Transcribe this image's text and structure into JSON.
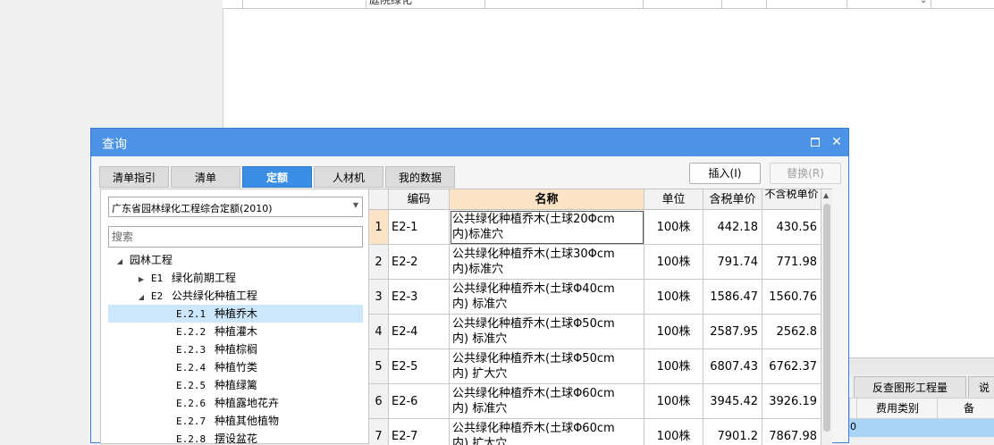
{
  "background": {
    "top_row_text": "庭院绿化"
  },
  "dialog": {
    "title": "查询",
    "tabs": [
      "清单指引",
      "清单",
      "定额",
      "人材机",
      "我的数据"
    ],
    "active_tab": "定额",
    "insert_button": "插入(I)",
    "replace_button": "替换(R)",
    "library_select": "广东省园林绿化工程综合定额(2010)",
    "search_placeholder": "搜索",
    "tree": [
      {
        "label": "园林工程",
        "toggle": "◢"
      },
      {
        "code": "E1",
        "label": "绿化前期工程",
        "toggle": "▶"
      },
      {
        "code": "E2",
        "label": "公共绿化种植工程",
        "toggle": "◢"
      },
      {
        "code": "E.2.1",
        "label": "种植乔木",
        "selected": true
      },
      {
        "code": "E.2.2",
        "label": "种植灌木"
      },
      {
        "code": "E.2.3",
        "label": "种植棕榈"
      },
      {
        "code": "E.2.4",
        "label": "种植竹类"
      },
      {
        "code": "E.2.5",
        "label": "种植绿篱"
      },
      {
        "code": "E.2.6",
        "label": "种植露地花卉"
      },
      {
        "code": "E.2.7",
        "label": "种植其他植物"
      },
      {
        "code": "E.2.8",
        "label": "摆设盆花"
      }
    ],
    "grid": {
      "headers": [
        "编码",
        "名称",
        "单位",
        "含税单价",
        "不含税单价"
      ],
      "rows": [
        {
          "idx": "1",
          "code": "E2-1",
          "name_l1": "公共绿化种植乔木(土球20Φcm",
          "name_l2": "内)标准穴",
          "unit": "100株",
          "price_tax": "442.18",
          "price_notax": "430.56"
        },
        {
          "idx": "2",
          "code": "E2-2",
          "name_l1": "公共绿化种植乔木(土球30Φcm",
          "name_l2": "内)标准穴",
          "unit": "100株",
          "price_tax": "791.74",
          "price_notax": "771.98"
        },
        {
          "idx": "3",
          "code": "E2-3",
          "name_l1": "公共绿化种植乔木(土球Φ40cm",
          "name_l2": "内) 标准穴",
          "unit": "100株",
          "price_tax": "1586.47",
          "price_notax": "1560.76"
        },
        {
          "idx": "4",
          "code": "E2-4",
          "name_l1": "公共绿化种植乔木(土球Φ50cm",
          "name_l2": "内) 标准穴",
          "unit": "100株",
          "price_tax": "2587.95",
          "price_notax": "2562.8"
        },
        {
          "idx": "5",
          "code": "E2-5",
          "name_l1": "公共绿化种植乔木(土球Φ50cm",
          "name_l2": "内) 扩大穴",
          "unit": "100株",
          "price_tax": "6807.43",
          "price_notax": "6762.37"
        },
        {
          "idx": "6",
          "code": "E2-6",
          "name_l1": "公共绿化种植乔木(土球Φ60cm",
          "name_l2": "内) 标准穴",
          "unit": "100株",
          "price_tax": "3945.42",
          "price_notax": "3926.19"
        },
        {
          "idx": "7",
          "code": "E2-7",
          "name_l1": "公共绿化种植乔木(土球Φ60cm",
          "name_l2": "内) 扩大穴",
          "unit": "100株",
          "price_tax": "7901.2",
          "price_notax": "7867.98"
        }
      ]
    }
  },
  "bottom_panel": {
    "tabs": [
      "反查图形工程量",
      "说"
    ],
    "headers": [
      "费用类别",
      "备"
    ],
    "row_first": "0"
  }
}
